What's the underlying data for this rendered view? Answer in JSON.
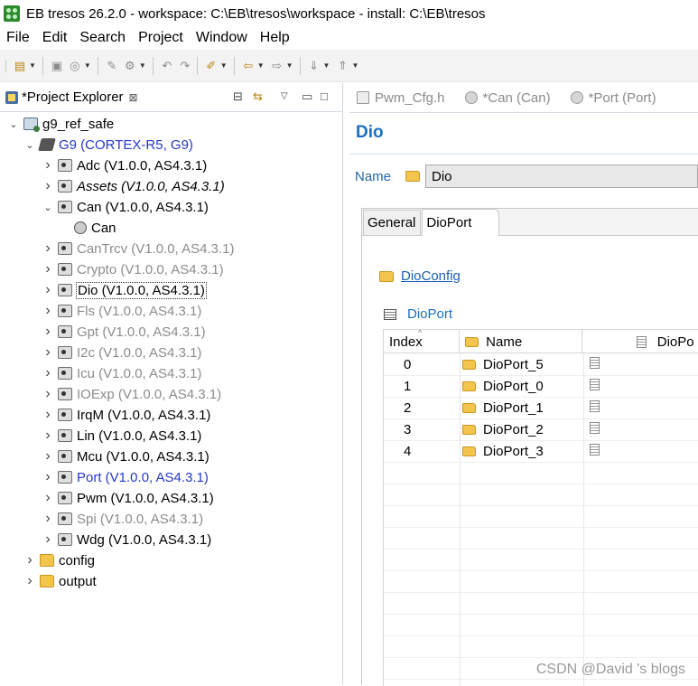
{
  "window": {
    "title": "EB tresos 26.2.0 - workspace: C:\\EB\\tresos\\workspace - install: C:\\EB\\tresos"
  },
  "menubar": {
    "items": [
      "File",
      "Edit",
      "Search",
      "Project",
      "Window",
      "Help"
    ]
  },
  "project_explorer": {
    "tab_label": "*Project Explorer",
    "close_glyph": "⊠",
    "tree": [
      {
        "label": "g9_ref_safe",
        "level": 0,
        "expanded": true,
        "icon": "project-icon",
        "style": "normal"
      },
      {
        "label": "G9 (CORTEX-R5, G9)",
        "level": 1,
        "expanded": true,
        "icon": "chip-icon",
        "style": "blue"
      },
      {
        "label": "Adc (V1.0.0, AS4.3.1)",
        "level": 2,
        "expanded": false,
        "icon": "module-icon",
        "style": "normal"
      },
      {
        "label": "Assets (V1.0.0, AS4.3.1)",
        "level": 2,
        "expanded": false,
        "icon": "module-icon",
        "style": "italic"
      },
      {
        "label": "Can (V1.0.0, AS4.3.1)",
        "level": 2,
        "expanded": true,
        "icon": "module-icon",
        "style": "normal"
      },
      {
        "label": "Can",
        "level": 3,
        "expanded": null,
        "icon": "gear-icon",
        "style": "normal"
      },
      {
        "label": "CanTrcv (V1.0.0, AS4.3.1)",
        "level": 2,
        "expanded": false,
        "icon": "module-icon",
        "style": "gray"
      },
      {
        "label": "Crypto (V1.0.0, AS4.3.1)",
        "level": 2,
        "expanded": false,
        "icon": "module-icon",
        "style": "gray"
      },
      {
        "label": "Dio (V1.0.0, AS4.3.1)",
        "level": 2,
        "expanded": false,
        "icon": "module-icon",
        "style": "selected"
      },
      {
        "label": "Fls (V1.0.0, AS4.3.1)",
        "level": 2,
        "expanded": false,
        "icon": "module-icon",
        "style": "gray"
      },
      {
        "label": "Gpt (V1.0.0, AS4.3.1)",
        "level": 2,
        "expanded": false,
        "icon": "module-icon",
        "style": "gray"
      },
      {
        "label": "I2c (V1.0.0, AS4.3.1)",
        "level": 2,
        "expanded": false,
        "icon": "module-icon",
        "style": "gray"
      },
      {
        "label": "Icu (V1.0.0, AS4.3.1)",
        "level": 2,
        "expanded": false,
        "icon": "module-icon",
        "style": "gray"
      },
      {
        "label": "IOExp (V1.0.0, AS4.3.1)",
        "level": 2,
        "expanded": false,
        "icon": "module-icon",
        "style": "gray"
      },
      {
        "label": "IrqM (V1.0.0, AS4.3.1)",
        "level": 2,
        "expanded": false,
        "icon": "module-icon",
        "style": "normal"
      },
      {
        "label": "Lin (V1.0.0, AS4.3.1)",
        "level": 2,
        "expanded": false,
        "icon": "module-icon",
        "style": "normal"
      },
      {
        "label": "Mcu (V1.0.0, AS4.3.1)",
        "level": 2,
        "expanded": false,
        "icon": "module-icon",
        "style": "normal"
      },
      {
        "label": "Port (V1.0.0, AS4.3.1)",
        "level": 2,
        "expanded": false,
        "icon": "module-icon",
        "style": "blue"
      },
      {
        "label": "Pwm (V1.0.0, AS4.3.1)",
        "level": 2,
        "expanded": false,
        "icon": "module-icon",
        "style": "normal"
      },
      {
        "label": "Spi (V1.0.0, AS4.3.1)",
        "level": 2,
        "expanded": false,
        "icon": "module-icon",
        "style": "gray"
      },
      {
        "label": "Wdg (V1.0.0, AS4.3.1)",
        "level": 2,
        "expanded": false,
        "icon": "module-icon",
        "style": "normal"
      },
      {
        "label": "config",
        "level": 1,
        "expanded": false,
        "icon": "folder-icon",
        "style": "normal"
      },
      {
        "label": "output",
        "level": 1,
        "expanded": false,
        "icon": "folder-icon",
        "style": "normal"
      }
    ]
  },
  "editor": {
    "tabs": [
      {
        "label": "Pwm_Cfg.h",
        "icon": "header-file-icon"
      },
      {
        "label": "*Can (Can)",
        "icon": "module-config-icon"
      },
      {
        "label": "*Port (Port)",
        "icon": "module-config-icon"
      }
    ],
    "title": "Dio",
    "name_label": "Name",
    "name_value": "Dio",
    "subtabs": [
      "General",
      "DioPort"
    ],
    "active_subtab": "DioPort",
    "config_link": "DioConfig",
    "table_heading": "DioPort",
    "table": {
      "columns": [
        "Index",
        "Name",
        "DioPo"
      ],
      "sort_caret": "^",
      "rows": [
        {
          "index": "0",
          "name": "DioPort_5"
        },
        {
          "index": "1",
          "name": "DioPort_0"
        },
        {
          "index": "2",
          "name": "DioPort_1"
        },
        {
          "index": "3",
          "name": "DioPort_2"
        },
        {
          "index": "4",
          "name": "DioPort_3"
        }
      ]
    }
  },
  "watermark": "CSDN @David 's blogs",
  "colors": {
    "link_blue": "#1a5fb4",
    "title_blue": "#1c6fbf",
    "tree_blue": "#2538c8",
    "disabled_gray": "#8c8c8c"
  }
}
